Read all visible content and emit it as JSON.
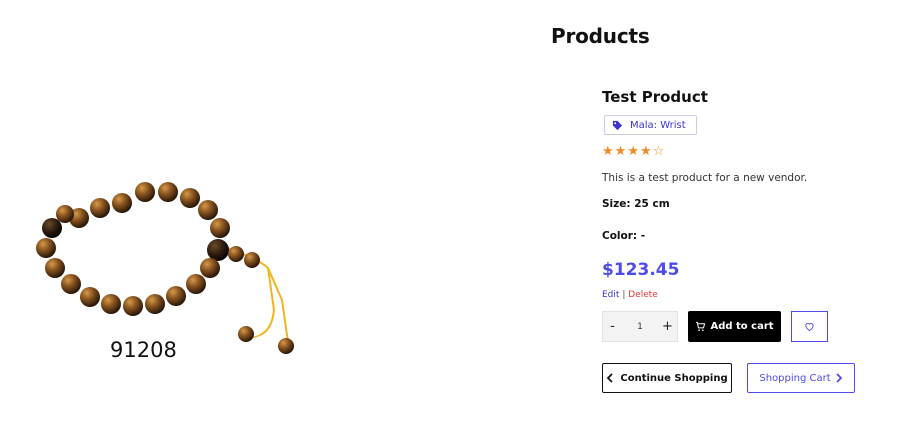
{
  "page": {
    "title": "Products"
  },
  "image": {
    "code": "91208"
  },
  "product": {
    "name": "Test Product",
    "category": "Mala: Wrist",
    "rating": 4,
    "rating_max": 5,
    "description": "This is a test product for a new vendor.",
    "size_text": "Size: 25 cm",
    "color_text": "Color: -",
    "price": "$123.45"
  },
  "admin": {
    "edit": "Edit",
    "separator": "|",
    "delete": "Delete"
  },
  "cart": {
    "minus": "-",
    "quantity": "1",
    "plus": "+",
    "add_label": "Add to cart"
  },
  "nav": {
    "continue_label": "Continue Shopping",
    "cart_label": "Shopping Cart"
  },
  "colors": {
    "accent": "#4f4be8",
    "star": "#f08a24",
    "delete": "#e53935"
  }
}
